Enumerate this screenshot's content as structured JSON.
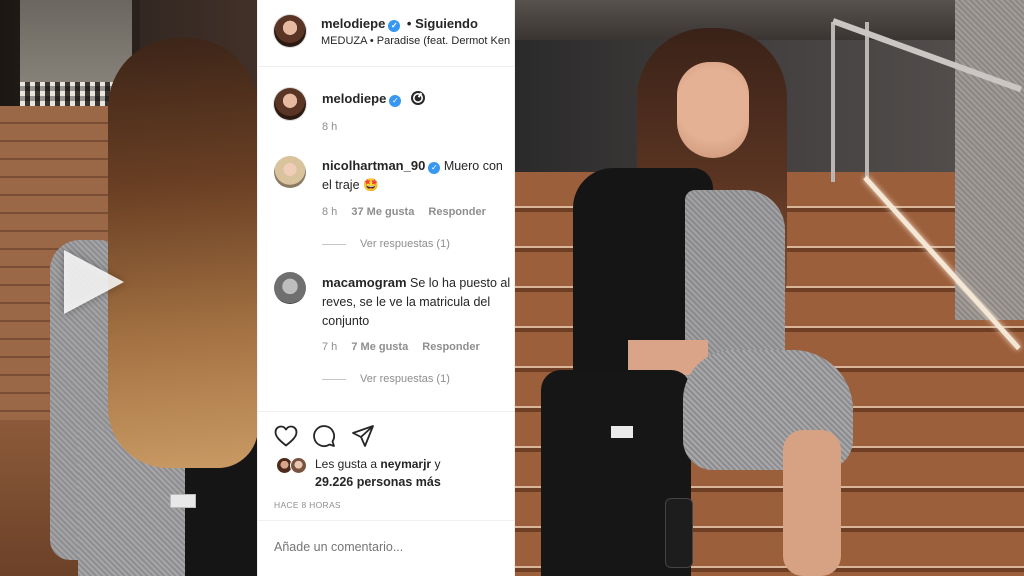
{
  "post": {
    "author": "melodiepe",
    "separator": "•",
    "follow_status": "Siguiendo",
    "audio": "MEDUZA • Paradise (feat. Dermot Ken",
    "caption_time": "8 h"
  },
  "comments": [
    {
      "username": "nicolhartman_90",
      "verified": true,
      "text": "Muero con el traje 🤩",
      "time": "8 h",
      "likes": "37 Me gusta",
      "reply_label": "Responder",
      "view_replies": "Ver respuestas (1)"
    },
    {
      "username": "macamogram",
      "verified": false,
      "text": "Se lo ha puesto al reves, se le ve la matricula del conjunto",
      "time": "7 h",
      "likes": "7 Me gusta",
      "reply_label": "Responder",
      "view_replies": "Ver respuestas (1)"
    }
  ],
  "likes": {
    "prefix": "Les gusta a",
    "liker": "neymarjr",
    "suffix": "y",
    "count": "29.226 personas más"
  },
  "timestamp": "HACE 8 HORAS",
  "comment_input": {
    "placeholder": "Añade un comentario..."
  },
  "icons": {
    "verified": "verified-badge-icon",
    "threads": "threads-icon",
    "like": "heart-icon",
    "comment": "comment-bubble-icon",
    "share": "paper-plane-icon",
    "play": "play-icon"
  },
  "colors": {
    "verified_blue": "#3897f0",
    "secondary_text": "#8e8e8e",
    "primary_text": "#262626"
  }
}
